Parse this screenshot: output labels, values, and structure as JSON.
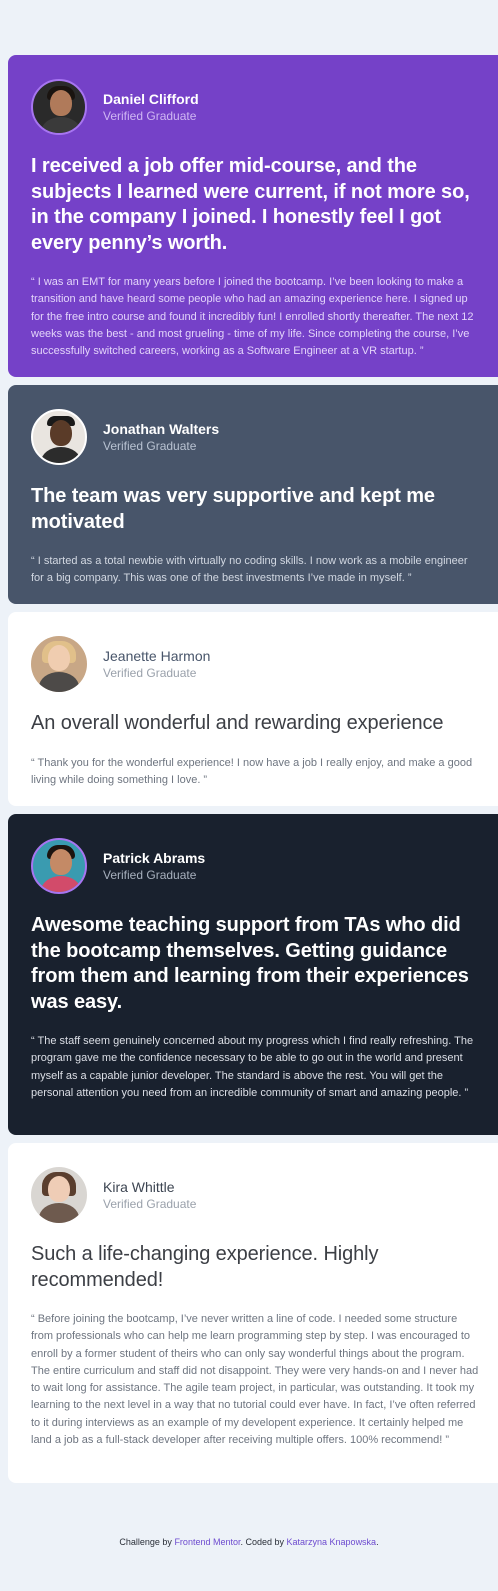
{
  "testimonials": [
    {
      "name": "Daniel Clifford",
      "role": "Verified Graduate",
      "headline": "I received a job offer mid-course, and the subjects I learned were current, if not more so, in the company I joined. I honestly feel I got every penny’s worth.",
      "quote": "“ I was an EMT for many years before I joined the bootcamp. I’ve been looking to make a transition and have heard some people who had an amazing experience here. I signed up for the free intro course and found it incredibly fun! I enrolled shortly thereafter. The next 12 weeks was the best - and most grueling - time of my life. Since completing the course, I’ve successfully switched careers, working as a Software Engineer at a VR startup. ”"
    },
    {
      "name": "Jonathan Walters",
      "role": "Verified Graduate",
      "headline": "The team was very supportive and kept me motivated",
      "quote": "“ I started as a total newbie with virtually no coding skills. I now work as a mobile engineer for a big company. This was one of the best investments I’ve made in myself. ”"
    },
    {
      "name": "Jeanette Harmon",
      "role": "Verified Graduate",
      "headline": "An overall wonderful and rewarding experience",
      "quote": "“ Thank you for the wonderful experience! I now have a job I really enjoy, and make a good living while doing something I love. ”"
    },
    {
      "name": "Patrick Abrams",
      "role": "Verified Graduate",
      "headline": "Awesome teaching support from TAs who did the bootcamp themselves. Getting guidance from them and learning from their experiences was easy.",
      "quote": "“ The staff seem genuinely concerned about my progress which I find really refreshing. The program gave me the confidence necessary to be able to go out in the world and present myself as a capable junior developer. The standard is above the rest. You will get the personal attention you need from an incredible community of smart and amazing people. ”"
    },
    {
      "name": "Kira Whittle",
      "role": "Verified Graduate",
      "headline": "Such a life-changing experience. Highly recommended!",
      "quote": "“ Before joining the bootcamp, I’ve never written a line of code. I needed some structure from professionals who can help me learn programming step by step. I was encouraged to enroll by a former student of theirs who can only say wonderful things about the program. The entire curriculum and staff did not disappoint. They were very hands-on and I never had to wait long for assistance. The agile team project, in particular, was outstanding. It took my learning to the next level in a way that no tutorial could ever have. In fact, I’ve often referred to it during interviews as an example of my developent experience. It certainly helped me land a job as a full-stack developer after receiving multiple offers. 100% recommend! ”"
    }
  ],
  "footer": {
    "prefix": "Challenge by ",
    "link1": "Frontend Mentor",
    "middle": ". Coded by ",
    "link2": "Katarzyna Knapowska",
    "suffix": "."
  },
  "colors": {
    "page_bg": "#edf2f8",
    "moderate_violet": "#7541c8",
    "grayish_blue": "#48556a",
    "very_dark_blackish_blue": "#19212e",
    "white": "#ffffff"
  }
}
